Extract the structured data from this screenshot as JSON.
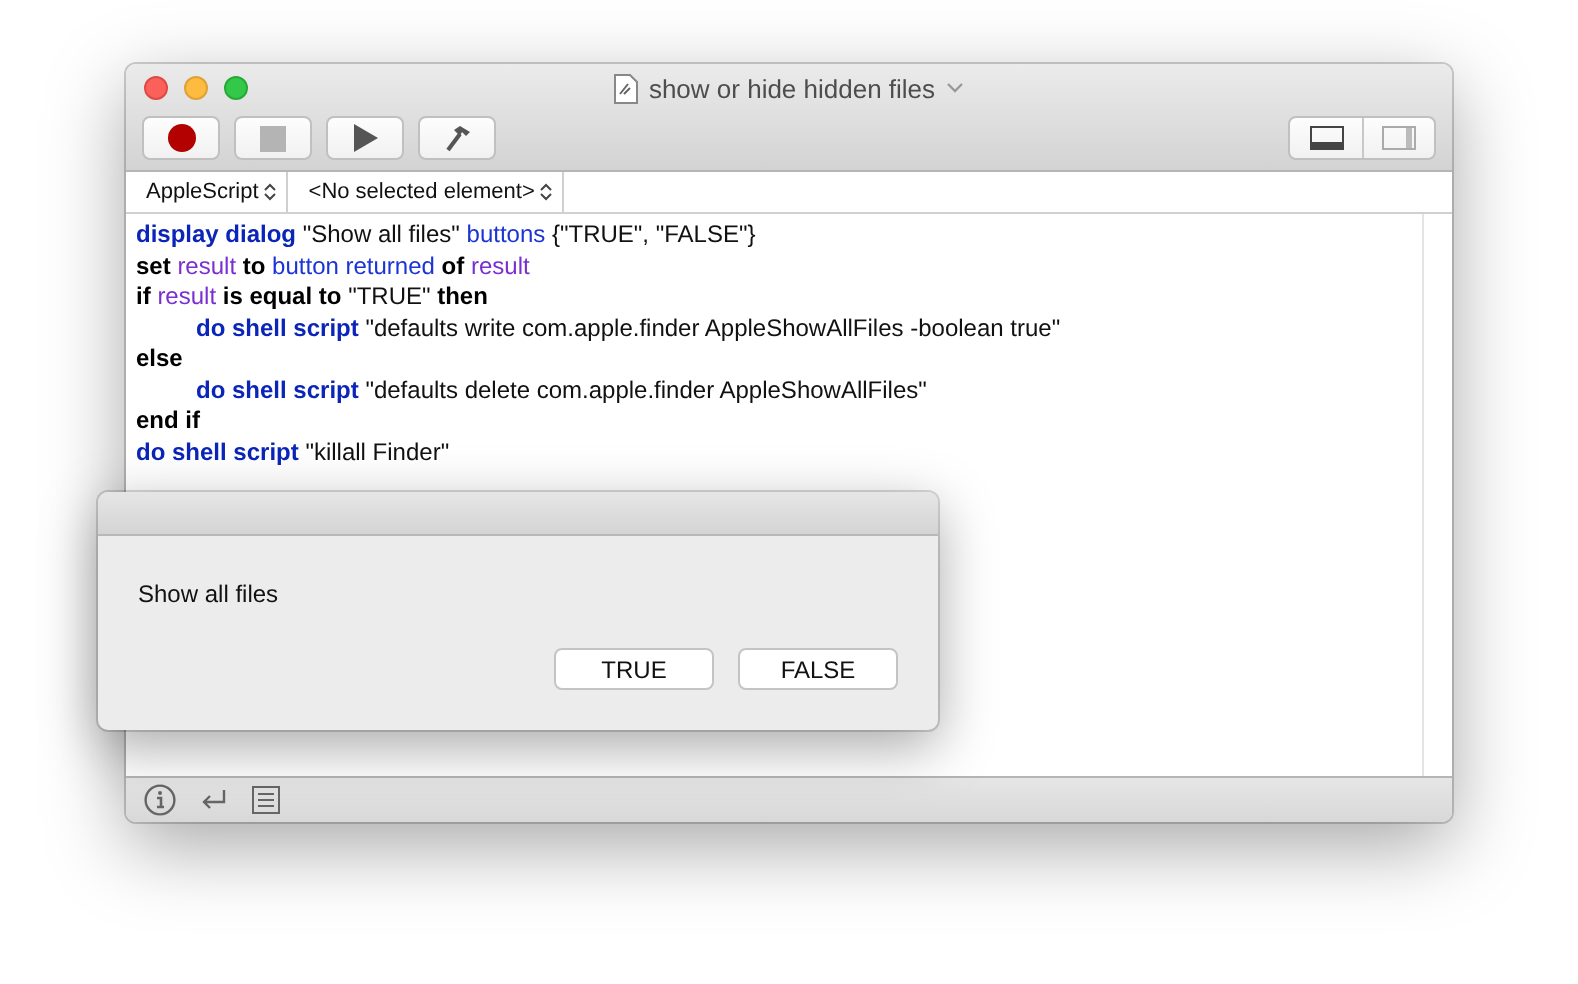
{
  "window": {
    "title": "show or hide hidden files"
  },
  "navigation_bar": {
    "language": "AppleScript",
    "element": "<No selected element>"
  },
  "code": [
    {
      "indented": false,
      "tokens": [
        {
          "kind": "command",
          "text": "display dialog"
        },
        {
          "kind": "text",
          "text": "\"Show all files\""
        },
        {
          "kind": "param",
          "text": "buttons"
        },
        {
          "kind": "text",
          "text": "{\"TRUE\", \"FALSE\"}"
        }
      ]
    },
    {
      "indented": false,
      "tokens": [
        {
          "kind": "keyword",
          "text": "set"
        },
        {
          "kind": "variable",
          "text": "result"
        },
        {
          "kind": "keyword",
          "text": "to"
        },
        {
          "kind": "param",
          "text": "button returned"
        },
        {
          "kind": "keyword",
          "text": "of"
        },
        {
          "kind": "variable",
          "text": "result"
        }
      ]
    },
    {
      "indented": false,
      "tokens": [
        {
          "kind": "keyword",
          "text": "if"
        },
        {
          "kind": "variable",
          "text": "result"
        },
        {
          "kind": "keyword",
          "text": "is equal to"
        },
        {
          "kind": "text",
          "text": "\"TRUE\""
        },
        {
          "kind": "keyword",
          "text": "then"
        }
      ]
    },
    {
      "indented": true,
      "tokens": [
        {
          "kind": "command",
          "text": "do shell script"
        },
        {
          "kind": "text",
          "text": "\"defaults write com.apple.finder AppleShowAllFiles -boolean true\""
        }
      ]
    },
    {
      "indented": false,
      "tokens": [
        {
          "kind": "keyword",
          "text": "else"
        }
      ]
    },
    {
      "indented": true,
      "tokens": [
        {
          "kind": "command",
          "text": "do shell script"
        },
        {
          "kind": "text",
          "text": "\"defaults delete com.apple.finder AppleShowAllFiles\""
        }
      ]
    },
    {
      "indented": false,
      "tokens": [
        {
          "kind": "keyword",
          "text": "end if"
        }
      ]
    },
    {
      "indented": false,
      "tokens": [
        {
          "kind": "command",
          "text": "do shell script"
        },
        {
          "kind": "text",
          "text": "\"killall Finder\""
        }
      ]
    }
  ],
  "dialog": {
    "message": "Show all files",
    "buttons": [
      "TRUE",
      "FALSE"
    ]
  }
}
